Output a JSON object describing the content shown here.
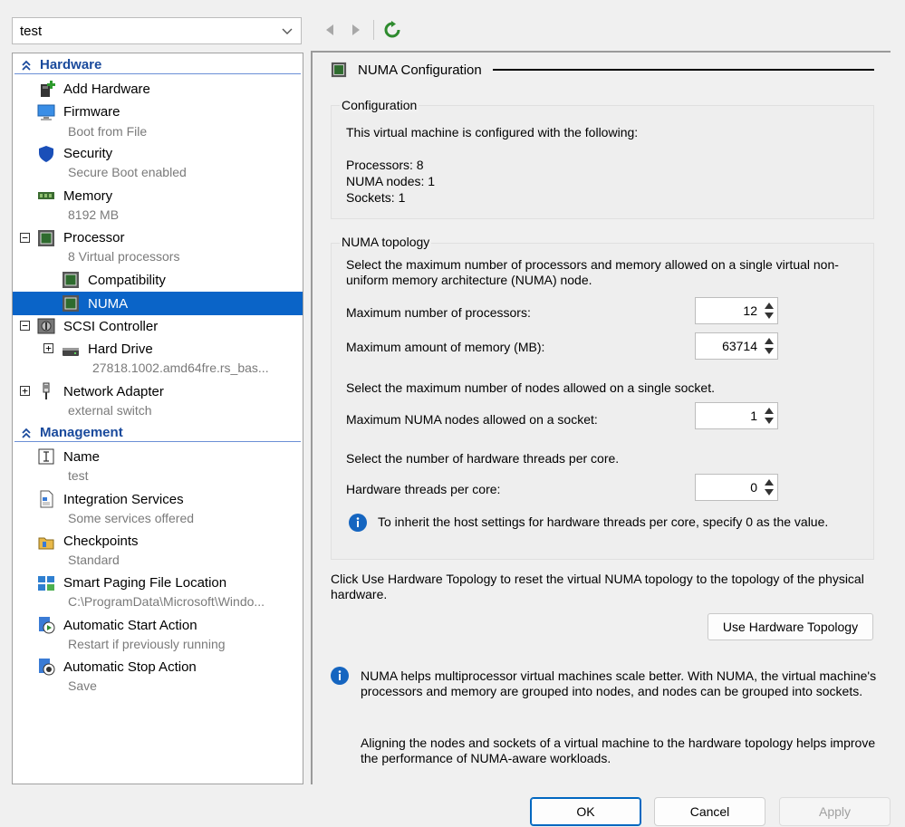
{
  "vm_selector": {
    "value": "test"
  },
  "nav": {
    "back": "back-arrow",
    "forward": "forward-arrow",
    "refresh": "refresh"
  },
  "tree": {
    "hardware_header": "Hardware",
    "management_header": "Management",
    "items": {
      "add_hardware": {
        "label": "Add Hardware"
      },
      "firmware": {
        "label": "Firmware",
        "sub": "Boot from File"
      },
      "security": {
        "label": "Security",
        "sub": "Secure Boot enabled"
      },
      "memory": {
        "label": "Memory",
        "sub": "8192 MB"
      },
      "processor": {
        "label": "Processor",
        "sub": "8 Virtual processors"
      },
      "compatibility": {
        "label": "Compatibility"
      },
      "numa": {
        "label": "NUMA"
      },
      "scsi": {
        "label": "SCSI Controller"
      },
      "hard_drive": {
        "label": "Hard Drive",
        "sub": "27818.1002.amd64fre.rs_bas..."
      },
      "network": {
        "label": "Network Adapter",
        "sub": "external switch"
      },
      "name": {
        "label": "Name",
        "sub": "test"
      },
      "integration": {
        "label": "Integration Services",
        "sub": "Some services offered"
      },
      "checkpoints": {
        "label": "Checkpoints",
        "sub": "Standard"
      },
      "smart_paging": {
        "label": "Smart Paging File Location",
        "sub": "C:\\ProgramData\\Microsoft\\Windo..."
      },
      "auto_start": {
        "label": "Automatic Start Action",
        "sub": "Restart if previously running"
      },
      "auto_stop": {
        "label": "Automatic Stop Action",
        "sub": "Save"
      }
    }
  },
  "panel": {
    "title": "NUMA Configuration",
    "configuration": {
      "title": "Configuration",
      "intro": "This virtual machine is configured with the following:",
      "processors": "Processors: 8",
      "numa_nodes": "NUMA nodes: 1",
      "sockets": "Sockets: 1"
    },
    "topology": {
      "title": "NUMA topology",
      "desc1": "Select the maximum number of processors and memory allowed on a single virtual non-uniform memory architecture (NUMA) node.",
      "max_proc_label": "Maximum number of processors:",
      "max_proc_value": "12",
      "max_mem_label": "Maximum amount of memory (MB):",
      "max_mem_value": "63714",
      "desc2": "Select the maximum number of nodes allowed on a single socket.",
      "max_nodes_label": "Maximum NUMA nodes allowed on a socket:",
      "max_nodes_value": "1",
      "desc3": "Select the number of hardware threads per core.",
      "threads_label": "Hardware threads per core:",
      "threads_value": "0",
      "threads_info": "To inherit the host settings for hardware threads per core, specify 0 as the value."
    },
    "hw_topology_desc": "Click Use Hardware Topology to reset the virtual NUMA topology to the topology of the physical hardware.",
    "hw_topology_button": "Use Hardware Topology",
    "info1": "NUMA helps multiprocessor virtual machines scale better.  With NUMA, the virtual machine's processors and memory are grouped into nodes, and nodes can be grouped into sockets.",
    "info2": "Aligning the nodes and sockets of a virtual machine to the hardware topology helps improve the performance of NUMA-aware workloads."
  },
  "buttons": {
    "ok": "OK",
    "cancel": "Cancel",
    "apply": "Apply"
  },
  "colors": {
    "accent": "#0a64c8",
    "section": "#1a4a9c",
    "chip_green": "#2e6b2e",
    "info_blue": "#1565c0",
    "refresh_green": "#2e8b2e"
  }
}
